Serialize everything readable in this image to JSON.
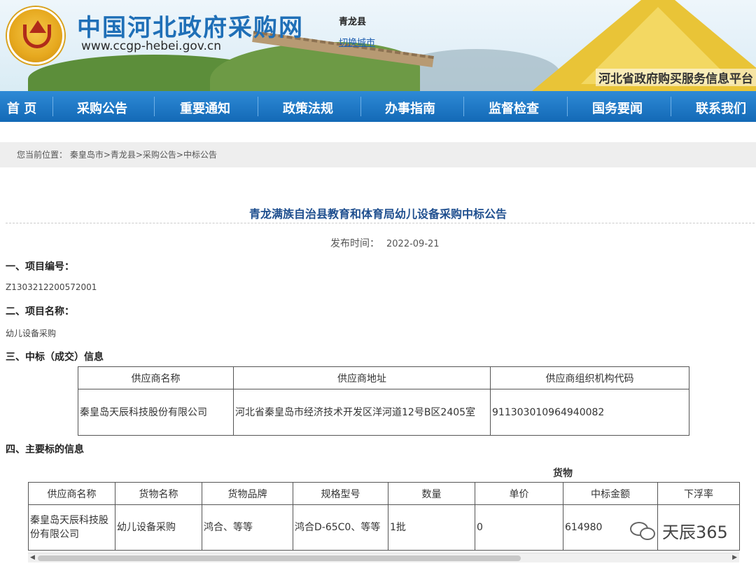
{
  "header": {
    "site_title": "中国河北政府采购网",
    "site_url": "www.ccgp-hebei.gov.cn",
    "region": "青龙县",
    "switch_city": "切换城市",
    "platform_name": "河北省政府购买服务信息平台"
  },
  "nav": {
    "items": [
      "首 页",
      "采购公告",
      "重要通知",
      "政策法规",
      "办事指南",
      "监督检查",
      "国务要闻",
      "联系我们"
    ]
  },
  "breadcrumb": "您当前位置： 秦皇岛市>青龙县>采购公告>中标公告",
  "article": {
    "title": "青龙满族自治县教育和体育局幼儿设备采购中标公告",
    "publish_label": "发布时间：",
    "publish_date": "2022-09-21",
    "section1_heading": "一、项目编号：",
    "project_number": "Z1303212200572001",
    "section2_heading": "二、项目名称：",
    "project_name": "幼儿设备采购",
    "section3_heading": "三、中标（成交）信息",
    "supplier_table": {
      "headers": [
        "供应商名称",
        "供应商地址",
        "供应商组织机构代码"
      ],
      "row": [
        "秦皇岛天辰科技股份有限公司",
        "河北省秦皇岛市经济技术开发区洋河道12号B区2405室",
        "911303010964940082"
      ]
    },
    "section4_heading": "四、主要标的信息",
    "goods_label": "货物",
    "goods_table": {
      "headers": [
        "供应商名称",
        "货物名称",
        "货物品牌",
        "规格型号",
        "数量",
        "单价",
        "中标金额",
        "下浮率"
      ],
      "row": [
        "秦皇岛天辰科技股份有限公司",
        "幼儿设备采购",
        "鸿合、等等",
        "鸿合D-65C0、等等",
        "1批",
        "0",
        "614980",
        ""
      ]
    }
  },
  "watermark": "天辰365"
}
